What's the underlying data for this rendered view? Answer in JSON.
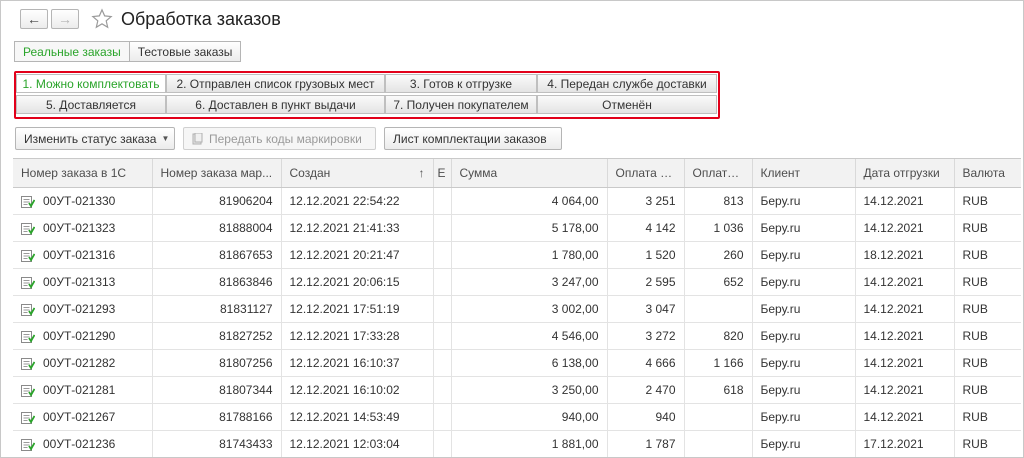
{
  "window": {
    "title": "Обработка заказов",
    "back_icon": "arrow-left-icon",
    "forward_icon": "arrow-right-icon",
    "favorite_icon": "star-icon"
  },
  "mode_tabs": [
    {
      "label": "Реальные заказы",
      "active": true
    },
    {
      "label": "Тестовые заказы",
      "active": false
    }
  ],
  "status_filters": [
    {
      "label": "1. Можно комплектовать",
      "active": true
    },
    {
      "label": "2. Отправлен список грузовых мест",
      "active": false
    },
    {
      "label": "3. Готов к отгрузке",
      "active": false
    },
    {
      "label": "4. Передан службе доставки",
      "active": false
    },
    {
      "label": "5. Доставляется",
      "active": false
    },
    {
      "label": "6. Доставлен в пункт выдачи",
      "active": false
    },
    {
      "label": "7. Получен покупателем",
      "active": false
    },
    {
      "label": "Отменён",
      "active": false
    }
  ],
  "toolbar": {
    "change_status_label": "Изменить статус заказа",
    "transfer_codes_label": "Передать коды маркировки",
    "picking_list_label": "Лист комплектации заказов"
  },
  "table": {
    "columns": [
      "Номер заказа в 1С",
      "Номер заказа мар...",
      "Создан",
      "Е",
      "Сумма",
      "Оплата п...",
      "Оплата ...",
      "Клиент",
      "Дата отгрузки",
      "Валюта"
    ],
    "sort_indicator": "↑",
    "rows": [
      [
        "00УТ-021330",
        "81906204",
        "12.12.2021 22:54:22",
        "",
        "4 064,00",
        "3 251",
        "813",
        "Беру.ru",
        "14.12.2021",
        "RUB"
      ],
      [
        "00УТ-021323",
        "81888004",
        "12.12.2021 21:41:33",
        "",
        "5 178,00",
        "4 142",
        "1 036",
        "Беру.ru",
        "14.12.2021",
        "RUB"
      ],
      [
        "00УТ-021316",
        "81867653",
        "12.12.2021 20:21:47",
        "",
        "1 780,00",
        "1 520",
        "260",
        "Беру.ru",
        "18.12.2021",
        "RUB"
      ],
      [
        "00УТ-021313",
        "81863846",
        "12.12.2021 20:06:15",
        "",
        "3 247,00",
        "2 595",
        "652",
        "Беру.ru",
        "14.12.2021",
        "RUB"
      ],
      [
        "00УТ-021293",
        "81831127",
        "12.12.2021 17:51:19",
        "",
        "3 002,00",
        "3 047",
        "",
        "Беру.ru",
        "14.12.2021",
        "RUB"
      ],
      [
        "00УТ-021290",
        "81827252",
        "12.12.2021 17:33:28",
        "",
        "4 546,00",
        "3 272",
        "820",
        "Беру.ru",
        "14.12.2021",
        "RUB"
      ],
      [
        "00УТ-021282",
        "81807256",
        "12.12.2021 16:10:37",
        "",
        "6 138,00",
        "4 666",
        "1 166",
        "Беру.ru",
        "14.12.2021",
        "RUB"
      ],
      [
        "00УТ-021281",
        "81807344",
        "12.12.2021 16:10:02",
        "",
        "3 250,00",
        "2 470",
        "618",
        "Беру.ru",
        "14.12.2021",
        "RUB"
      ],
      [
        "00УТ-021267",
        "81788166",
        "12.12.2021 14:53:49",
        "",
        "940,00",
        "940",
        "",
        "Беру.ru",
        "14.12.2021",
        "RUB"
      ],
      [
        "00УТ-021236",
        "81743433",
        "12.12.2021 12:03:04",
        "",
        "1 881,00",
        "1 787",
        "",
        "Беру.ru",
        "17.12.2021",
        "RUB"
      ]
    ]
  },
  "colors": {
    "active_green": "#2aa42a",
    "highlight_red": "#e2001a"
  }
}
